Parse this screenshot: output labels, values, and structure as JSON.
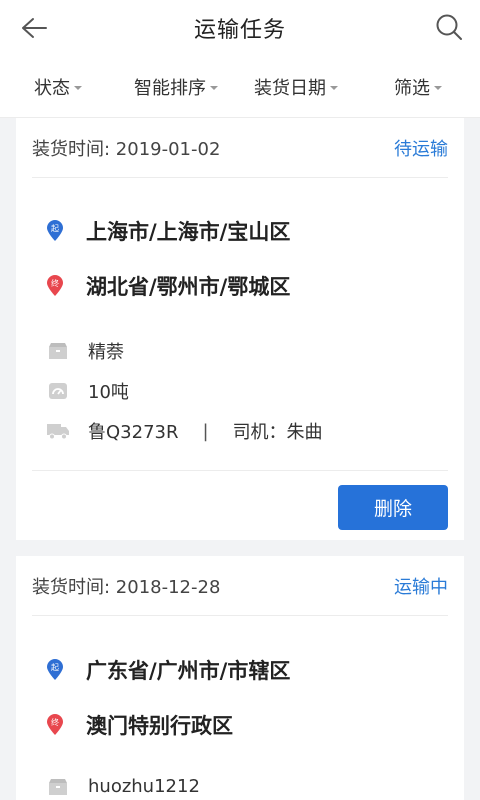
{
  "header": {
    "title": "运输任务"
  },
  "filters": [
    {
      "label": "状态"
    },
    {
      "label": "智能排序"
    },
    {
      "label": "装货日期"
    },
    {
      "label": "筛选"
    }
  ],
  "colors": {
    "accent": "#2672d9",
    "status": "#2a7bd7",
    "origin_pin": "#2f6fd4",
    "dest_pin": "#e8474e"
  },
  "icons": {
    "back": "arrow-left-icon",
    "search": "search-icon",
    "origin": "origin-pin-icon",
    "dest": "destination-pin-icon",
    "cargo": "box-icon",
    "weight": "gauge-icon",
    "truck": "truck-icon"
  },
  "pins": {
    "origin_char": "起",
    "dest_char": "终"
  },
  "tasks": [
    {
      "load_time": "装货时间: 2019-01-02",
      "status": "待运输",
      "origin": "上海市/上海市/宝山区",
      "destination": "湖北省/鄂州市/鄂城区",
      "cargo": "精萘",
      "weight": "10吨",
      "plate": "鲁Q3273R",
      "separator": "|",
      "driver": "司机：朱曲",
      "delete_label": "删除"
    },
    {
      "load_time": "装货时间: 2018-12-28",
      "status": "运输中",
      "origin": "广东省/广州市/市辖区",
      "destination": "澳门特别行政区",
      "cargo": "huozhu1212"
    }
  ]
}
